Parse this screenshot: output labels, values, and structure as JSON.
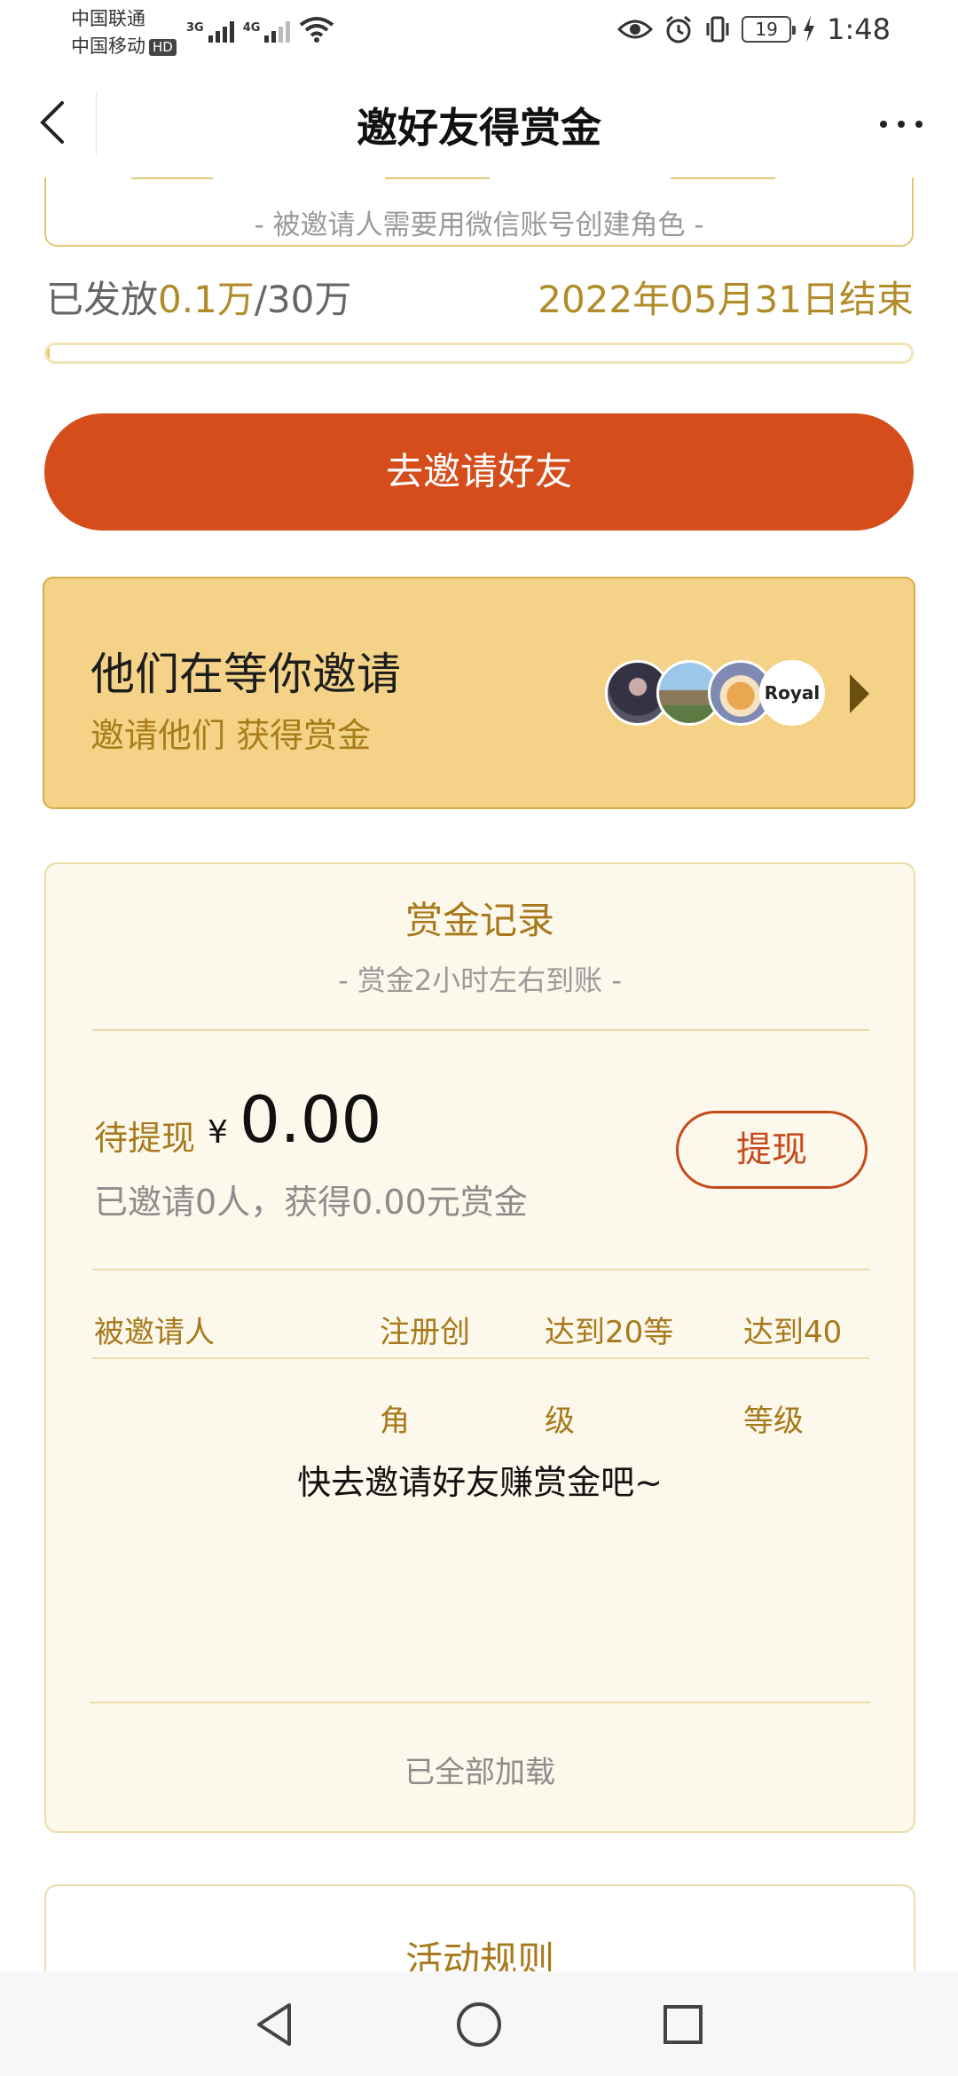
{
  "status_bar": {
    "carrier_1": "中国联通",
    "carrier_2": "中国移动",
    "hd": "HD",
    "net_1": "3G",
    "net_2": "4G",
    "battery": "19",
    "time": "1:48"
  },
  "nav": {
    "title": "邀好友得赏金"
  },
  "campaign": {
    "note": "- 被邀请人需要用微信账号创建角色 -",
    "issued_prefix": "已发放",
    "issued_amount": "0.1万",
    "issued_total": "/30万",
    "end_date": "2022年05月31日结束",
    "progress": 0.0033
  },
  "invite_button": "去邀请好友",
  "waiting": {
    "title": "他们在等你邀请",
    "subtitle": "邀请他们 获得赏金",
    "avatar_4_text": "Royal"
  },
  "records": {
    "title": "赏金记录",
    "note": "- 赏金2小时左右到账 -",
    "pending_label": "待提现",
    "currency": "¥",
    "amount": "0.00",
    "summary": "已邀请0人，获得0.00元赏金",
    "withdraw": "提现",
    "columns": {
      "invitee": "被邀请人",
      "register_1": "注册创",
      "register_2": "角",
      "level20_1": "达到20等",
      "level20_2": "级",
      "level40_1": "达到40",
      "level40_2": "等级"
    },
    "empty": "快去邀请好友赚赏金吧~",
    "loaded_all": "已全部加载"
  },
  "rules": {
    "title": "活动规则"
  },
  "colors": {
    "accent": "#d44d1b",
    "gold": "#a7791b",
    "card_yellow": "#f4d388"
  }
}
